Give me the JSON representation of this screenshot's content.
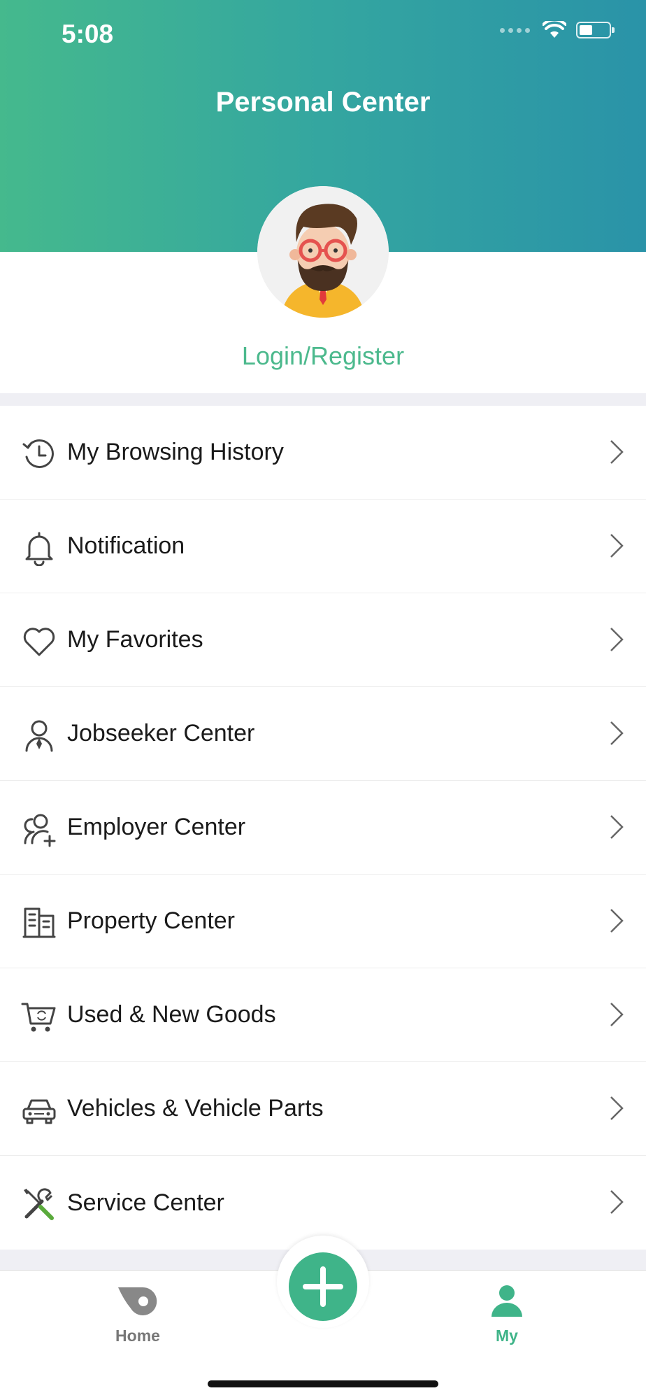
{
  "status_bar": {
    "time": "5:08"
  },
  "header": {
    "title": "Personal Center"
  },
  "profile": {
    "login_label": "Login/Register"
  },
  "menu": [
    {
      "label": "My Browsing History",
      "icon": "history-icon"
    },
    {
      "label": "Notification",
      "icon": "bell-icon"
    },
    {
      "label": "My Favorites",
      "icon": "heart-icon"
    },
    {
      "label": "Jobseeker Center",
      "icon": "jobseeker-icon"
    },
    {
      "label": "Employer Center",
      "icon": "employer-icon"
    },
    {
      "label": "Property Center",
      "icon": "building-icon"
    },
    {
      "label": "Used & New Goods",
      "icon": "cart-icon"
    },
    {
      "label": "Vehicles & Vehicle Parts",
      "icon": "car-icon"
    },
    {
      "label": "Service Center",
      "icon": "tools-icon"
    }
  ],
  "tabbar": {
    "home_label": "Home",
    "my_label": "My",
    "active_tab": "My",
    "accent_color": "#3fb489"
  }
}
